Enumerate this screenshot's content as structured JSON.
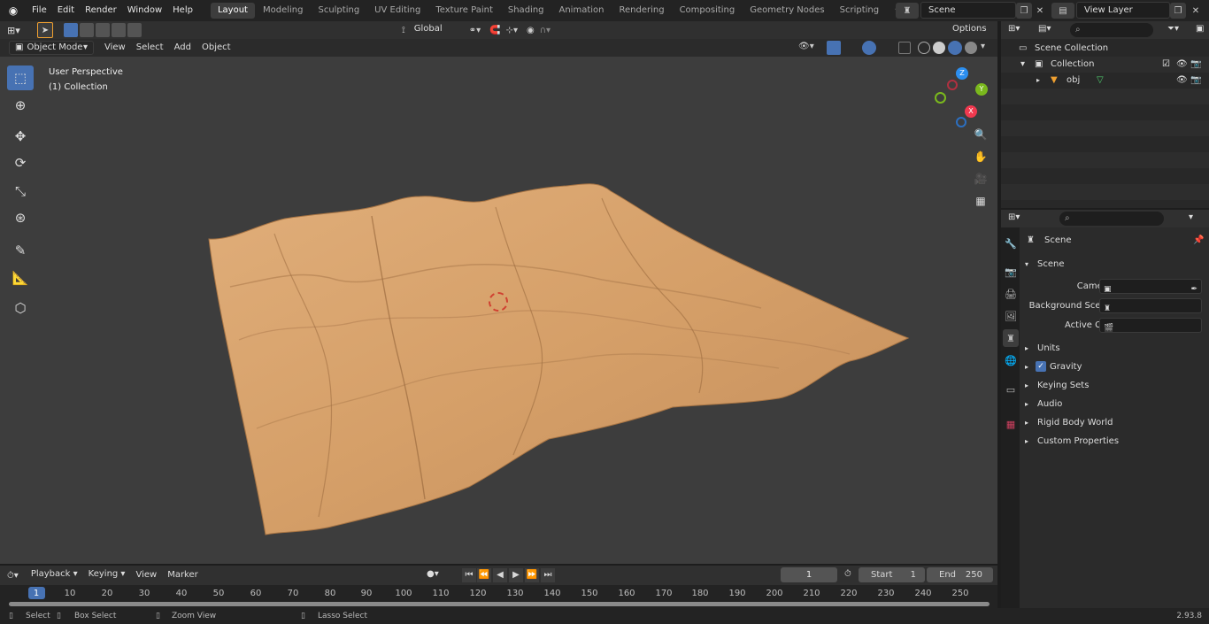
{
  "menu": {
    "items": [
      "File",
      "Edit",
      "Render",
      "Window",
      "Help"
    ]
  },
  "workspaces": [
    "Layout",
    "Modeling",
    "Sculpting",
    "UV Editing",
    "Texture Paint",
    "Shading",
    "Animation",
    "Rendering",
    "Compositing",
    "Geometry Nodes",
    "Scripting"
  ],
  "active_workspace": "Layout",
  "scene_name": "Scene",
  "view_layer_name": "View Layer",
  "viewport": {
    "transform_orientation": "Global",
    "options_label": "Options",
    "mode": "Object Mode",
    "header_menu": [
      "View",
      "Select",
      "Add",
      "Object"
    ],
    "overlay_title": "User Perspective",
    "overlay_subtitle": "(1) Collection",
    "gizmo_axes": {
      "x": "X",
      "y": "Y",
      "z": "Z"
    }
  },
  "outliner": {
    "root": "Scene Collection",
    "collection": "Collection",
    "object": "obj"
  },
  "properties": {
    "header": "Scene",
    "panel": "Scene",
    "fields": [
      {
        "label": "Camera"
      },
      {
        "label": "Background Scene"
      },
      {
        "label": "Active Clip"
      }
    ],
    "subpanels": [
      "Units",
      "Gravity",
      "Keying Sets",
      "Audio",
      "Rigid Body World",
      "Custom Properties"
    ],
    "gravity_checked": true
  },
  "timeline": {
    "menus": [
      "Playback",
      "Keying",
      "View",
      "Marker"
    ],
    "current_frame": "1",
    "start_label": "Start",
    "start_value": "1",
    "end_label": "End",
    "end_value": "250",
    "ruler": [
      "1",
      "10",
      "20",
      "30",
      "40",
      "50",
      "60",
      "70",
      "80",
      "90",
      "100",
      "110",
      "120",
      "130",
      "140",
      "150",
      "160",
      "170",
      "180",
      "190",
      "200",
      "210",
      "220",
      "230",
      "240",
      "250"
    ]
  },
  "status_bar": {
    "select": "Select",
    "box_select": "Box Select",
    "zoom_view": "Zoom View",
    "lasso_select": "Lasso Select",
    "version": "2.93.8"
  },
  "colors": {
    "accent": "#4772b3",
    "terrain": "#d9a36d",
    "viewport_bg": "#3d3d3d",
    "x_axis": "#f0394f",
    "y_axis": "#7ab81d",
    "z_axis": "#2c8ff0"
  }
}
